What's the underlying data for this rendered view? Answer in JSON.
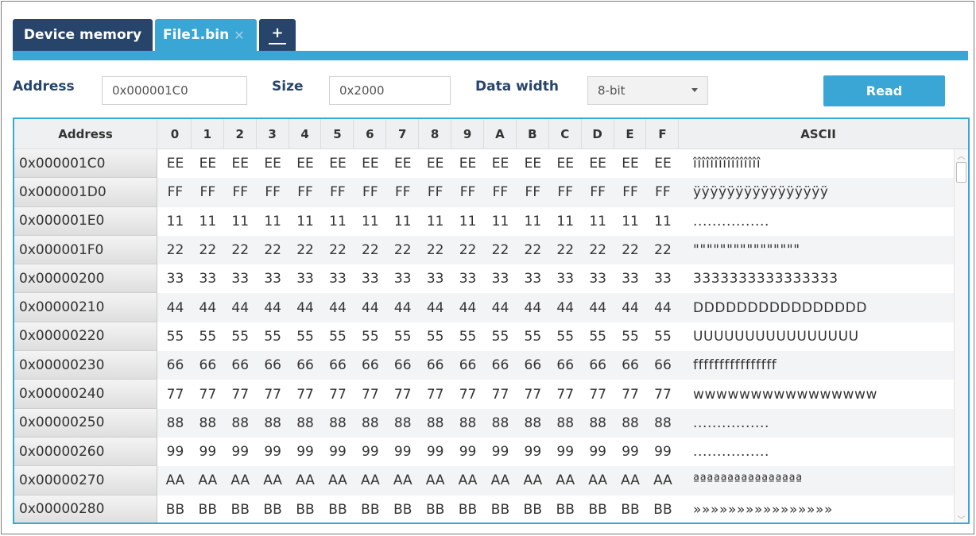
{
  "tabs": {
    "device_memory": "Device memory",
    "file": "File1.bin",
    "file_close": "✕",
    "add": "+"
  },
  "toolbar": {
    "address_label": "Address",
    "address_value": "0x000001C0",
    "size_label": "Size",
    "size_value": "0x2000",
    "data_width_label": "Data width",
    "data_width_value": "8-bit",
    "read_label": "Read"
  },
  "table": {
    "headers": {
      "address": "Address",
      "bytes": [
        "0",
        "1",
        "2",
        "3",
        "4",
        "5",
        "6",
        "7",
        "8",
        "9",
        "A",
        "B",
        "C",
        "D",
        "E",
        "F"
      ],
      "ascii": "ASCII"
    },
    "rows": [
      {
        "address": "0x000001C0",
        "byte": "EE",
        "ascii": "îîîîîîîîîîîîîîîî"
      },
      {
        "address": "0x000001D0",
        "byte": "FF",
        "ascii": "ÿÿÿÿÿÿÿÿÿÿÿÿÿÿÿÿ"
      },
      {
        "address": "0x000001E0",
        "byte": "11",
        "ascii": "................"
      },
      {
        "address": "0x000001F0",
        "byte": "22",
        "ascii": "\"\"\"\"\"\"\"\"\"\"\"\"\"\"\"\""
      },
      {
        "address": "0x00000200",
        "byte": "33",
        "ascii": "3333333333333333"
      },
      {
        "address": "0x00000210",
        "byte": "44",
        "ascii": "DDDDDDDDDDDDDDDD"
      },
      {
        "address": "0x00000220",
        "byte": "55",
        "ascii": "UUUUUUUUUUUUUUUU"
      },
      {
        "address": "0x00000230",
        "byte": "66",
        "ascii": "ffffffffffffffff"
      },
      {
        "address": "0x00000240",
        "byte": "77",
        "ascii": "wwwwwwwwwwwwwwww"
      },
      {
        "address": "0x00000250",
        "byte": "88",
        "ascii": "................"
      },
      {
        "address": "0x00000260",
        "byte": "99",
        "ascii": "................"
      },
      {
        "address": "0x00000270",
        "byte": "AA",
        "ascii": "ªªªªªªªªªªªªªªªª"
      },
      {
        "address": "0x00000280",
        "byte": "BB",
        "ascii": "»»»»»»»»»»»»»»»»"
      }
    ]
  },
  "colors": {
    "accent": "#3aa6d6",
    "navy": "#27446b"
  }
}
